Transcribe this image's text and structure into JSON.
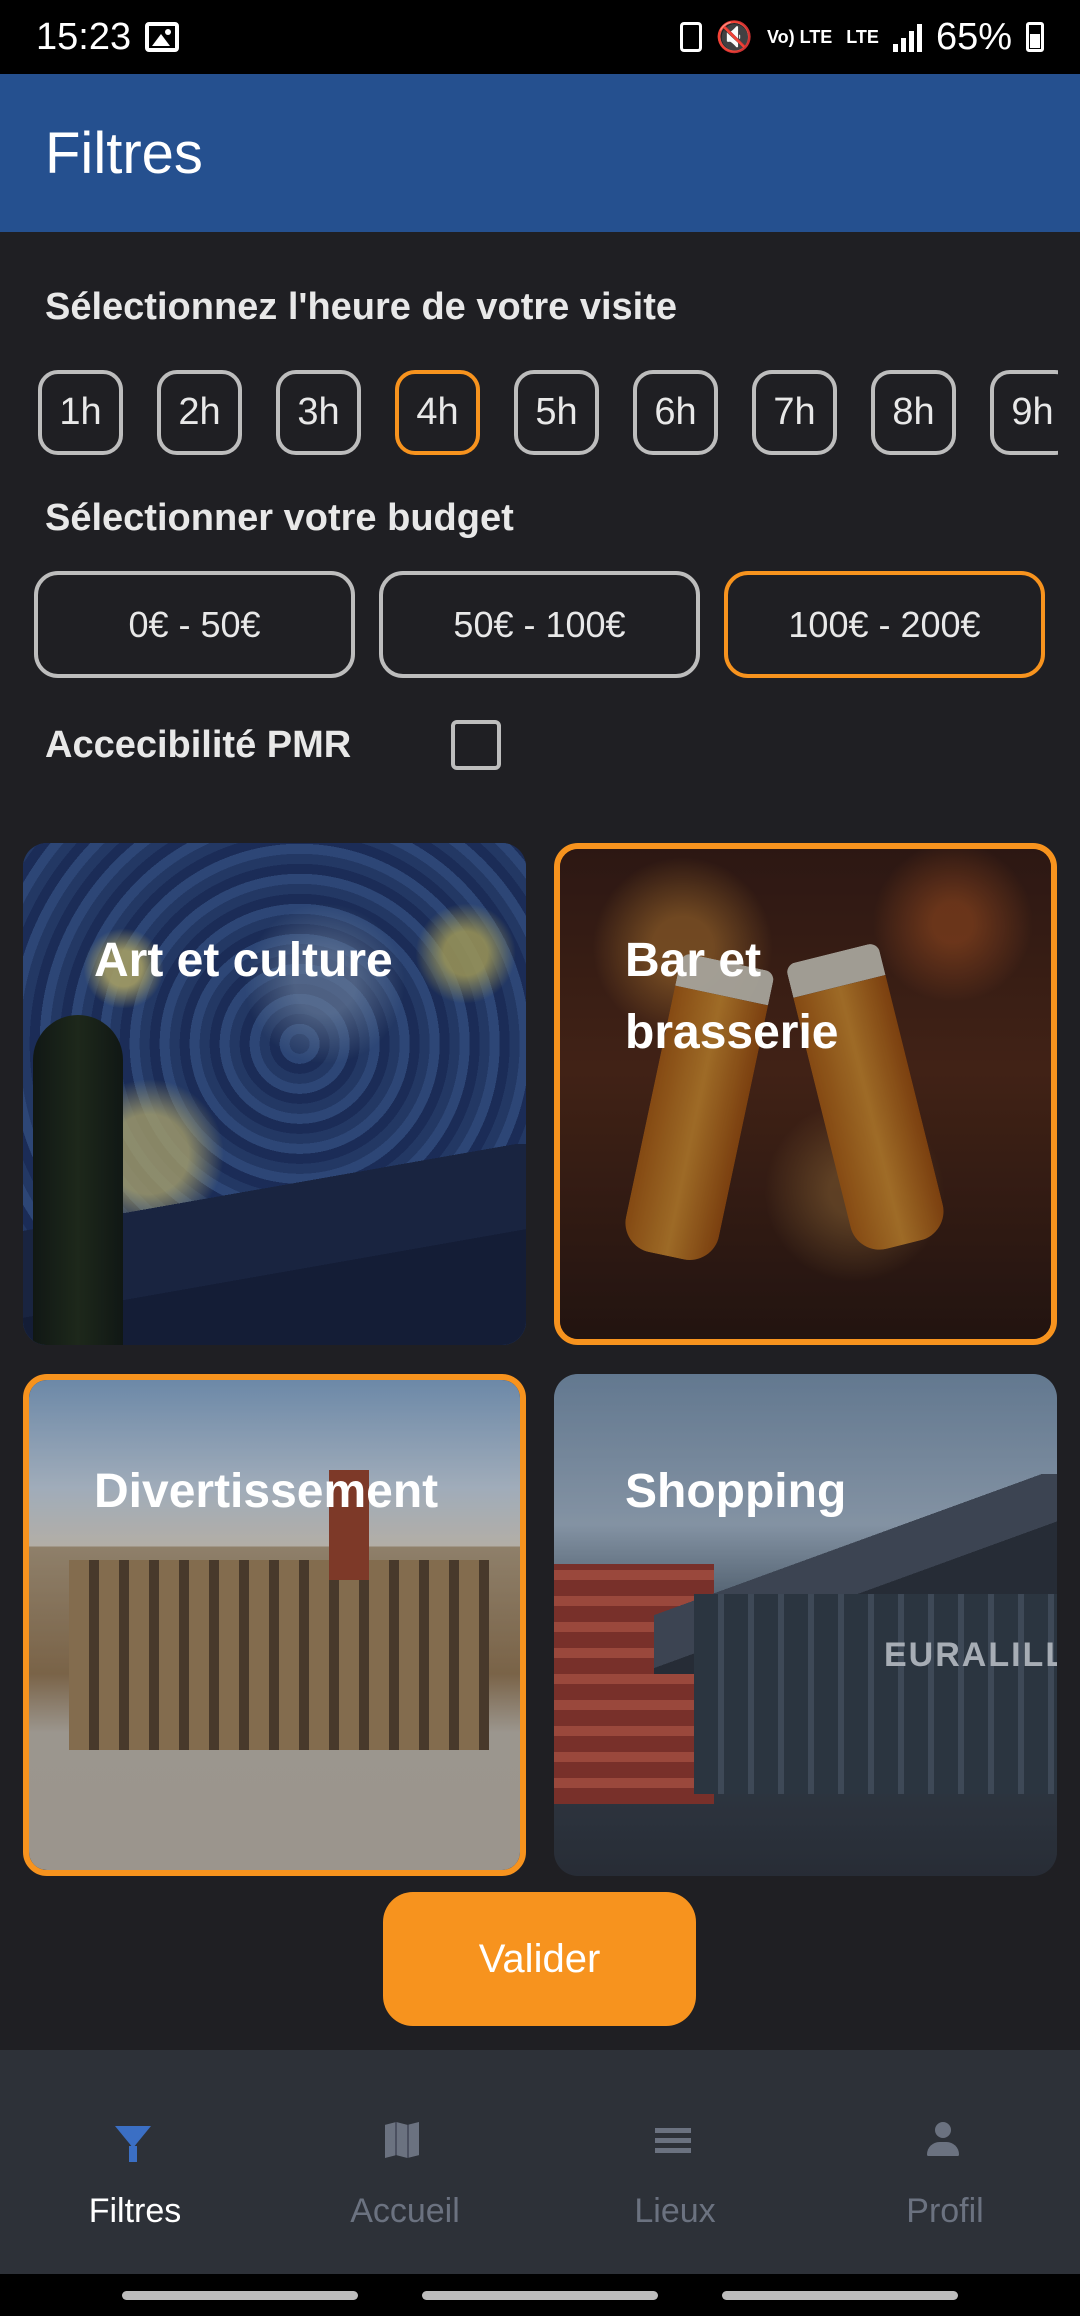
{
  "status_bar": {
    "time": "15:23",
    "network_volte": "Vo) LTE",
    "network_lte": "LTE",
    "battery": "65%"
  },
  "app_bar": {
    "title": "Filtres"
  },
  "hours": {
    "title": "Sélectionnez l'heure de votre visite",
    "options": [
      "1h",
      "2h",
      "3h",
      "4h",
      "5h",
      "6h",
      "7h",
      "8h",
      "9h"
    ],
    "selected": "4h"
  },
  "budget": {
    "title": "Sélectionner votre budget",
    "options": [
      "0€ - 50€",
      "50€ - 100€",
      "100€ - 200€"
    ],
    "selected": "100€ - 200€"
  },
  "pmr": {
    "label": "Accecibilité PMR",
    "checked": false
  },
  "categories": [
    {
      "label": "Art et culture",
      "selected": false
    },
    {
      "label": "Bar et brasserie",
      "selected": true
    },
    {
      "label": "Divertissement",
      "selected": true
    },
    {
      "label": "Shopping",
      "selected": false,
      "sign": "EURALILLE"
    }
  ],
  "validate_button": {
    "label": "Valider"
  },
  "bottom_nav": {
    "items": [
      {
        "label": "Filtres",
        "icon": "filter-icon",
        "active": true
      },
      {
        "label": "Accueil",
        "icon": "map-icon",
        "active": false
      },
      {
        "label": "Lieux",
        "icon": "list-icon",
        "active": false
      },
      {
        "label": "Profil",
        "icon": "person-icon",
        "active": false
      }
    ]
  },
  "colors": {
    "accent": "#f7931e",
    "app_bar": "#25508f",
    "background": "#1f1f23",
    "nav_active_icon": "#3b6fc4"
  }
}
